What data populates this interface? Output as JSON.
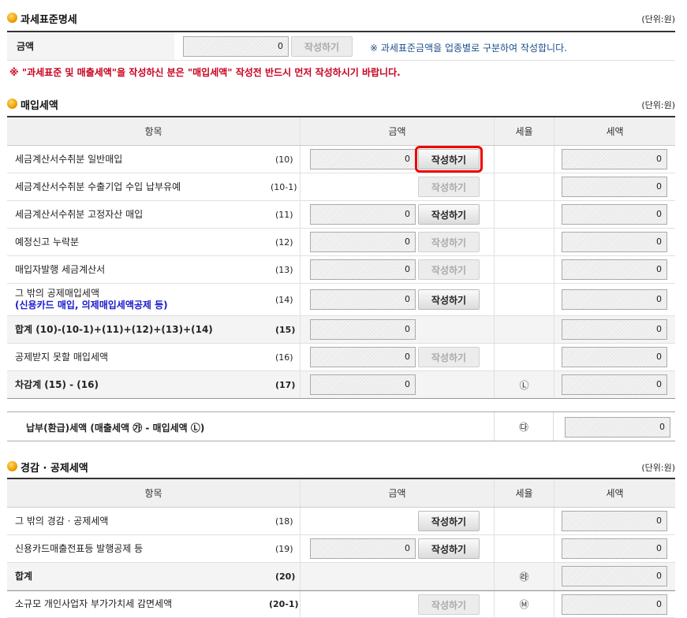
{
  "s1": {
    "title": "과세표준명세",
    "unit": "(단위:원)",
    "amount_label": "금액",
    "amount_value": "0",
    "write_btn": "작성하기",
    "note": "※ 과세표준금액을 업종별로 구분하여 작성합니다."
  },
  "warning": "※ \"과세표준 및 매출세액\"을 작성하신 분은 \"매입세액\" 작성전 반드시 먼저 작성하시기 바랍니다.",
  "s2": {
    "title": "매입세액",
    "unit": "(단위:원)",
    "headers": {
      "item": "항목",
      "amount": "금액",
      "rate": "세율",
      "tax": "세액"
    },
    "rows": [
      {
        "label": "세금계산서수취분 일반매입",
        "num": "(10)",
        "amount": "0",
        "btn": "작성하기",
        "tax": "0"
      },
      {
        "label": "세금계산서수취분 수출기업 수입 납부유예",
        "num": "(10-1)",
        "btn": "작성하기",
        "tax": "0"
      },
      {
        "label": "세금계산서수취분 고정자산 매입",
        "num": "(11)",
        "amount": "0",
        "btn": "작성하기",
        "tax": "0"
      },
      {
        "label": "예정신고 누락분",
        "num": "(12)",
        "amount": "0",
        "btn": "작성하기",
        "tax": "0"
      },
      {
        "label": "매입자발행 세금계산서",
        "num": "(13)",
        "amount": "0",
        "btn": "작성하기",
        "tax": "0"
      },
      {
        "label": "그 밖의 공제매입세액",
        "label2": "(신용카드 매입, 의제매입세액공제 등)",
        "num": "(14)",
        "amount": "0",
        "btn": "작성하기",
        "tax": "0"
      },
      {
        "label": "합계 (10)-(10-1)+(11)+(12)+(13)+(14)",
        "num": "(15)",
        "amount": "0",
        "tax": "0"
      },
      {
        "label": "공제받지 못할 매입세액",
        "num": "(16)",
        "amount": "0",
        "btn": "작성하기",
        "tax": "0"
      },
      {
        "label": "차감계 (15) - (16)",
        "num": "(17)",
        "amount": "0",
        "rate": "Ⓛ",
        "tax": "0"
      }
    ],
    "pay_label": "납부(환급)세액 (매출세액 ㉮ - 매입세액 Ⓛ)",
    "pay_rate": "㉰",
    "pay_value": "0"
  },
  "s3": {
    "title": "경감 · 공제세액",
    "unit": "(단위:원)",
    "headers": {
      "item": "항목",
      "amount": "금액",
      "rate": "세율",
      "tax": "세액"
    },
    "rows": [
      {
        "label": "그 밖의 경감 · 공제세액",
        "num": "(18)",
        "btn": "작성하기",
        "tax": "0"
      },
      {
        "label": "신용카드매출전표등 발행공제 등",
        "num": "(19)",
        "amount": "0",
        "btn": "작성하기",
        "tax": "0"
      },
      {
        "label": "합계",
        "num": "(20)",
        "rate": "㉱",
        "tax": "0"
      },
      {
        "label": "소규모 개인사업자 부가가치세 감면세액",
        "num": "(20-1)",
        "btn": "작성하기",
        "rate": "Ⓜ",
        "tax": "0"
      }
    ]
  }
}
